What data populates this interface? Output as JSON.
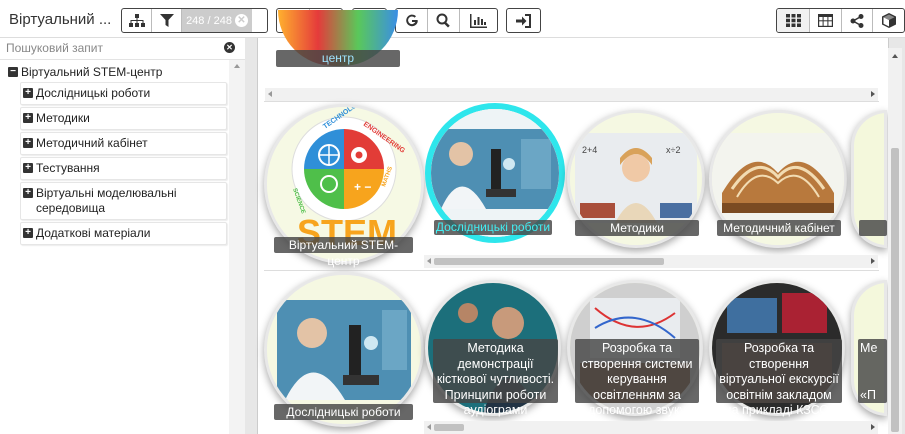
{
  "app": {
    "title": "Віртуальний ..."
  },
  "toolbar": {
    "counter": "248 / 248"
  },
  "sidebar": {
    "search_placeholder": "Пошуковий запит",
    "root": {
      "toggle": "−",
      "label": "Віртуальний STEM-центр"
    },
    "items": [
      {
        "toggle": "+",
        "label": "Дослідницькі роботи"
      },
      {
        "toggle": "+",
        "label": "Методики"
      },
      {
        "toggle": "+",
        "label": "Методичний кабінет"
      },
      {
        "toggle": "+",
        "label": "Тестування"
      },
      {
        "toggle": "+",
        "label": "Віртуальні моделювальні середовища"
      },
      {
        "toggle": "+",
        "label": "Додаткові матеріали"
      }
    ]
  },
  "main": {
    "top_partial_label": "центр",
    "row1": [
      {
        "label": "Віртуальний STEM-центр",
        "logo_words": [
          "TECHNOLOGY",
          "ENGINEERING",
          "SCIENCE",
          "MATHS",
          "STEM"
        ]
      },
      {
        "label": "Дослідницькі роботи"
      },
      {
        "label": "Методики"
      },
      {
        "label": "Методичний кабінет"
      }
    ],
    "row2": [
      {
        "label": "Дослідницькі роботи"
      },
      {
        "label": "Методика демонстрації кісткової чутливості. Принципи роботи аудіограми"
      },
      {
        "label": "Розробка та створення системи керування освітленням за допомогою звуку"
      },
      {
        "label": "Розробка та створення віртуальної екскурсії освітнім закладом (на прикладі КЗСОР"
      },
      {
        "label_top": "Ме",
        "label_bottom": "«П"
      }
    ]
  },
  "colors": {
    "highlight": "#2ee6ec",
    "label_bg": "#464646"
  }
}
